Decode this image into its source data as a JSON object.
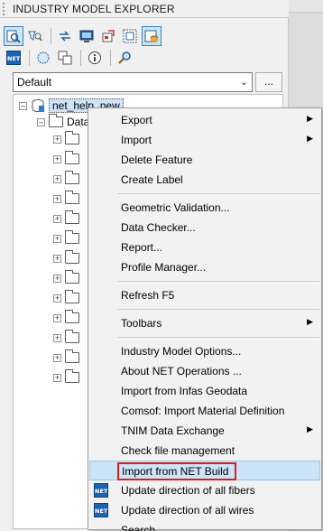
{
  "panel": {
    "title": "INDUSTRY MODEL EXPLORER"
  },
  "toolbar_row1": [
    "find-icon",
    "filter-icon",
    "redraw-icon",
    "monitor-icon",
    "export-icon",
    "table-icon",
    "database-icon"
  ],
  "toolbar_row2": [
    "net-icon",
    "polygon-icon",
    "copy-icon",
    "info-icon",
    "search-icon"
  ],
  "net_badge_text": "NET",
  "dropdown": {
    "value": "Default",
    "more_label": "..."
  },
  "tree": {
    "root_label": "net_help_new",
    "child_label": "Data",
    "child_count": 13
  },
  "context_menu": {
    "items": [
      {
        "label": "Export",
        "submenu": true
      },
      {
        "label": "Import",
        "submenu": true
      },
      {
        "label": "Delete Feature"
      },
      {
        "label": "Create Label"
      },
      {
        "separator": true
      },
      {
        "label": "Geometric Validation..."
      },
      {
        "label": "Data Checker..."
      },
      {
        "label": "Report..."
      },
      {
        "label": "Profile Manager..."
      },
      {
        "separator": true
      },
      {
        "label": "Refresh F5"
      },
      {
        "separator": true
      },
      {
        "label": "Toolbars",
        "submenu": true
      },
      {
        "separator": true
      },
      {
        "label": "Industry Model Options..."
      },
      {
        "label": "About NET Operations ..."
      },
      {
        "label": "Import from Infas Geodata"
      },
      {
        "label": "Comsof: Import Material Definition"
      },
      {
        "label": "TNIM Data Exchange",
        "submenu": true
      },
      {
        "label": "Check file management"
      },
      {
        "label": "Import from NET Build",
        "highlighted": true
      },
      {
        "label": "Update direction of all fibers",
        "icon": "net-icon"
      },
      {
        "label": "Update direction of all wires",
        "icon": "net-icon"
      },
      {
        "label": "Search..."
      }
    ]
  }
}
